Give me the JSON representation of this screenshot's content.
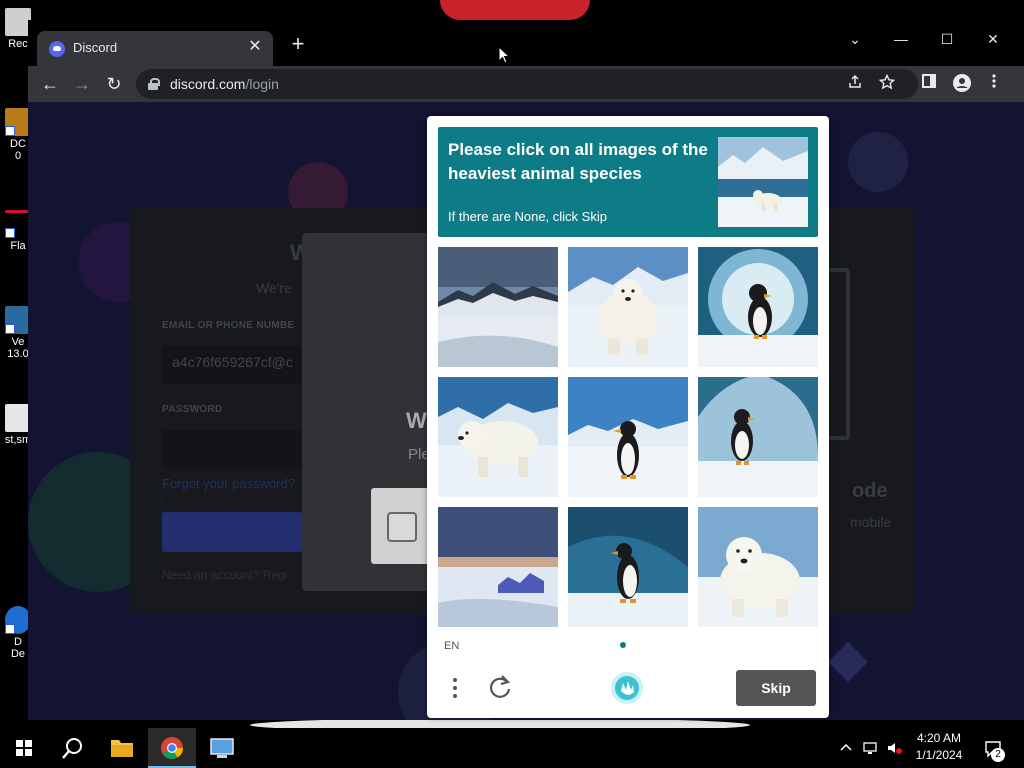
{
  "desktop": {
    "icons": [
      {
        "label": "Rec",
        "color": "#d8d8d8"
      },
      {
        "label": "DC\n0",
        "color": "#b87a1a"
      },
      {
        "label": "Fla",
        "color": "#8b0000"
      },
      {
        "label": "Ve\n13.0",
        "color": "#2a6aa0"
      },
      {
        "label": "st,sm",
        "color": "#e6e6e6"
      },
      {
        "label": "D\nDe",
        "color": "#1f6fd0"
      }
    ]
  },
  "browser": {
    "tab": {
      "title": "Discord",
      "close": "✕"
    },
    "new_tab": "+",
    "window_controls": {
      "dropdown": "⌄",
      "minimize": "—",
      "maximize": "☐",
      "close": "✕"
    },
    "nav": {
      "back": "←",
      "forward": "→",
      "reload": "↻"
    },
    "url": {
      "host": "discord.com",
      "path": "/login"
    },
    "toolbar_icons": [
      "share-icon",
      "star-icon",
      "sidepanel-icon",
      "profile-icon",
      "menu-icon"
    ]
  },
  "page": {
    "login": {
      "email_label": "EMAIL OR PHONE NUMBE",
      "email_value": "a4c76f659267cf@c",
      "password_label": "PASSWORD",
      "forgot": "Forgot your password?",
      "register": "Need an account? Regi",
      "welcome_fragment": "W",
      "subtitle_fragment": "We're",
      "qr_title_fragment": "ode",
      "qr_sub_fragment": "mobile"
    },
    "mid_modal": {
      "title_fragment": "W",
      "sub_fragment": "Ple"
    }
  },
  "captcha": {
    "prompt": "Please click on all images of the heaviest animal species",
    "hint": "If there are None, click Skip",
    "lang": "EN",
    "skip_label": "Skip",
    "accent": "#0d7c86",
    "tiles": [
      {
        "subject": "snowy mountains"
      },
      {
        "subject": "polar bear"
      },
      {
        "subject": "penguin in ice cave"
      },
      {
        "subject": "polar bear"
      },
      {
        "subject": "penguin"
      },
      {
        "subject": "penguin in ice cave"
      },
      {
        "subject": "snowy landscape"
      },
      {
        "subject": "penguin in ice cave"
      },
      {
        "subject": "polar bear"
      }
    ]
  },
  "taskbar": {
    "time": "4:20 AM",
    "date": "1/1/2024",
    "notifications": "2"
  }
}
